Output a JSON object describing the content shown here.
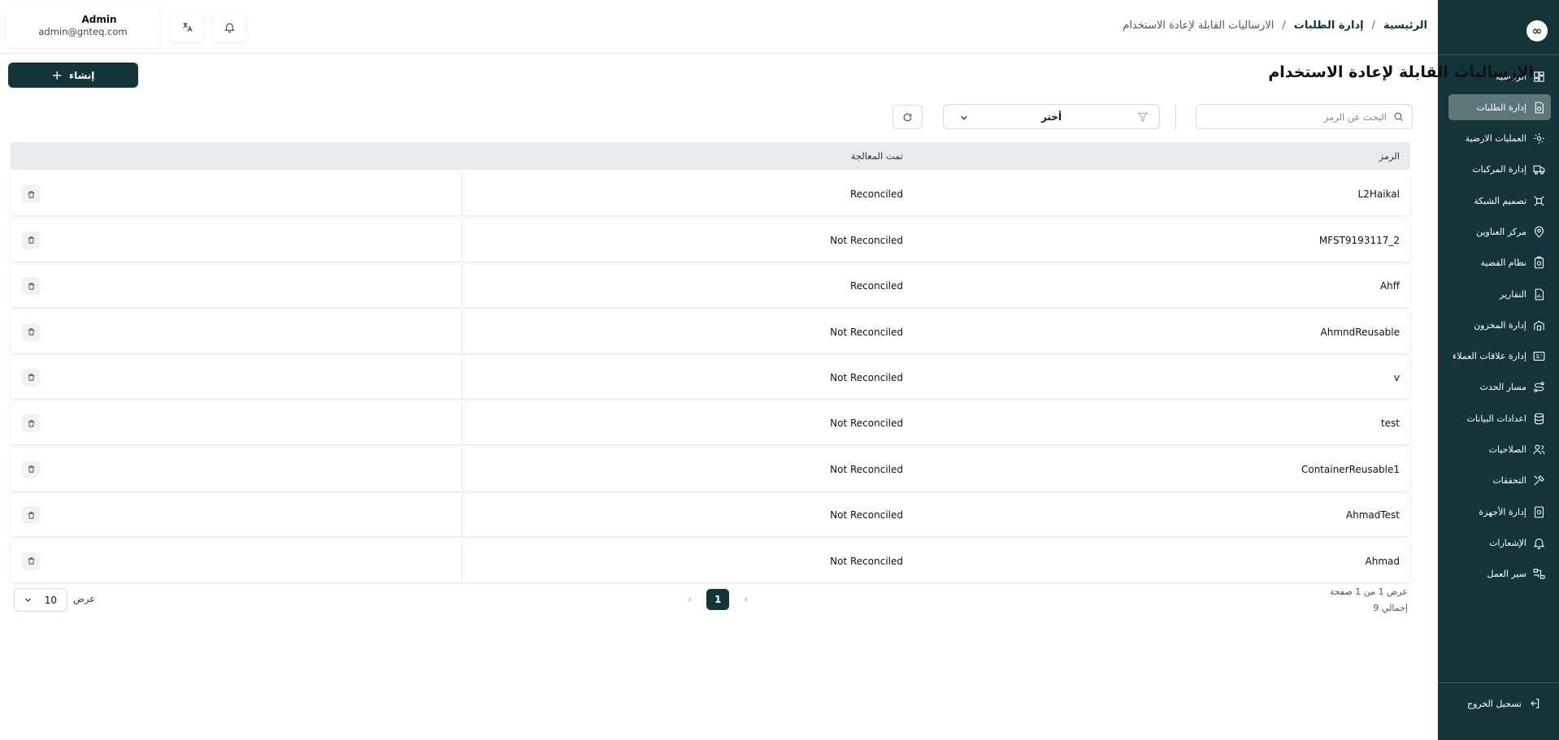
{
  "sidebar": {
    "logo": "∞",
    "items": [
      {
        "label": "الرئيسية",
        "icon": "dashboard-icon",
        "active": false
      },
      {
        "label": "إدارة الطلبات",
        "icon": "orders-icon",
        "active": true
      },
      {
        "label": "العمليات الارضية",
        "icon": "ground-ops-icon",
        "active": false
      },
      {
        "label": "إدارة المركبات",
        "icon": "truck-icon",
        "active": false
      },
      {
        "label": "تصميم الشبكة",
        "icon": "network-icon",
        "active": false
      },
      {
        "label": "مركز العناوين",
        "icon": "location-icon",
        "active": false
      },
      {
        "label": "نظام القضية",
        "icon": "case-icon",
        "active": false
      },
      {
        "label": "التقارير",
        "icon": "report-icon",
        "active": false
      },
      {
        "label": "إدارة المخزون",
        "icon": "inventory-icon",
        "active": false
      },
      {
        "label": "إدارة علاقات العملاء",
        "icon": "crm-icon",
        "active": false
      },
      {
        "label": "مسار الحدث",
        "icon": "route-icon",
        "active": false
      },
      {
        "label": "اعدادات البيانات",
        "icon": "database-icon",
        "active": false
      },
      {
        "label": "الصلاحيات",
        "icon": "users-icon",
        "active": false
      },
      {
        "label": "التحققات",
        "icon": "tools-icon",
        "active": false
      },
      {
        "label": "إدارة الأجهزة",
        "icon": "device-icon",
        "active": false
      },
      {
        "label": "الإشعارات",
        "icon": "bell-icon",
        "active": false
      },
      {
        "label": "سير العمل",
        "icon": "workflow-icon",
        "active": false
      }
    ],
    "logout": "تسجيل الخروج"
  },
  "header": {
    "user_name": "Admin",
    "user_email": "admin@gnteq.com",
    "breadcrumb": [
      "الرئيسية",
      "إدارة الطلبات",
      "الارساليات القابلة لإعادة الاستخدام"
    ],
    "separator": "/"
  },
  "page": {
    "title": "الارساليات القابلة لإعادة الاستخدام",
    "create_label": "إنشاء",
    "create_icon": "+",
    "search_placeholder": "البحث عن الرمز",
    "filter_value": "أختر"
  },
  "table": {
    "headers": {
      "code": "الرمز",
      "processed": "تمت المعالجة"
    },
    "rows": [
      {
        "code": "L2Haikal",
        "status": "Reconciled"
      },
      {
        "code": "MFST9193117_2",
        "status": "Not Reconciled"
      },
      {
        "code": "Ahff",
        "status": "Reconciled"
      },
      {
        "code": "AhmndReusable",
        "status": "Not Reconciled"
      },
      {
        "code": "v",
        "status": "Not Reconciled"
      },
      {
        "code": "test",
        "status": "Not Reconciled"
      },
      {
        "code": "ContainerReusable1",
        "status": "Not Reconciled"
      },
      {
        "code": "AhmadTest",
        "status": "Not Reconciled"
      },
      {
        "code": "Ahmad",
        "status": "Not Reconciled"
      }
    ]
  },
  "pagination": {
    "page_info": "عرض 1 من 1 صفحة",
    "total": "إجمالي 9",
    "current_page": "1",
    "prev": "‹",
    "next": "›",
    "per_page": "10",
    "per_page_label": "عرض"
  },
  "colors": {
    "sidebar_bg": "#133539",
    "active_item": "#5d7677",
    "accent": "#133539"
  }
}
